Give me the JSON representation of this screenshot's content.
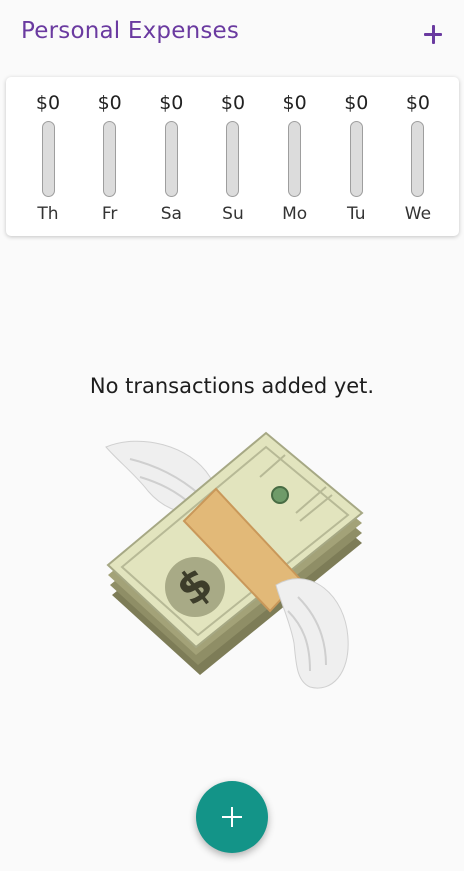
{
  "app": {
    "title": "Personal Expenses",
    "add_icon": "plus-icon"
  },
  "chart": {
    "bars": [
      {
        "amount": "$0",
        "day": "Th",
        "fraction": 0
      },
      {
        "amount": "$0",
        "day": "Fr",
        "fraction": 0
      },
      {
        "amount": "$0",
        "day": "Sa",
        "fraction": 0
      },
      {
        "amount": "$0",
        "day": "Su",
        "fraction": 0
      },
      {
        "amount": "$0",
        "day": "Mo",
        "fraction": 0
      },
      {
        "amount": "$0",
        "day": "Tu",
        "fraction": 0
      },
      {
        "amount": "$0",
        "day": "We",
        "fraction": 0
      }
    ]
  },
  "empty_state": {
    "message": "No transactions added yet.",
    "image": "money-with-wings-icon"
  },
  "fab": {
    "icon": "plus-icon"
  },
  "colors": {
    "primary": "#6a3aa0",
    "accent": "#139488"
  }
}
